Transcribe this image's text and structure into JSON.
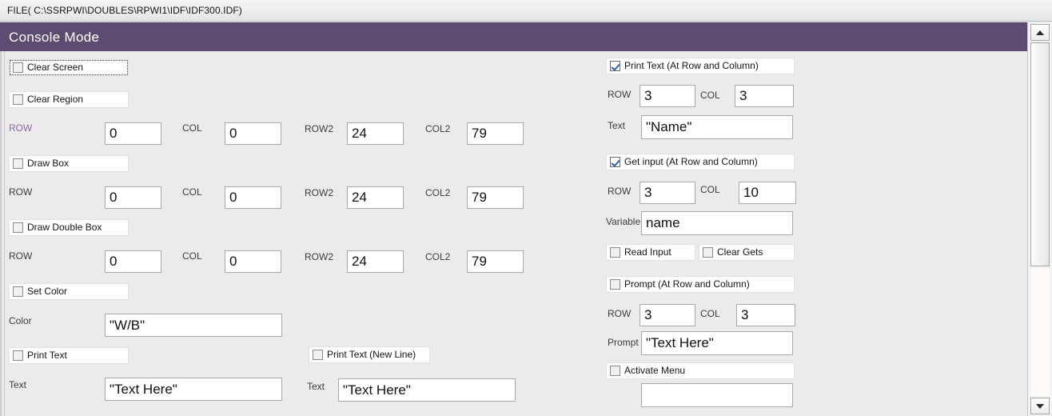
{
  "titlebar": {
    "file_path": "FILE( C:\\SSRPWI\\DOUBLES\\RPWI1\\IDF\\IDF300.IDF)"
  },
  "header": {
    "title": "Console Mode",
    "background_color": "#5e4b71",
    "text_color": "#ffffff"
  },
  "labels": {
    "row": "ROW",
    "col": "COL",
    "row2": "ROW2",
    "col2": "COL2",
    "color": "Color",
    "text": "Text",
    "variable": "Variable",
    "prompt": "Prompt"
  },
  "left_column": {
    "clear_screen": {
      "label": "Clear Screen",
      "checked": false,
      "focused": true
    },
    "clear_region": {
      "label": "Clear Region",
      "checked": false,
      "row_label": "ROW",
      "row_label_accent": true,
      "row_value": "0",
      "col_label": "COL",
      "col_value": "0",
      "row2_label": "ROW2",
      "row2_value": "24",
      "col2_label": "COL2",
      "col2_value": "79"
    },
    "draw_box": {
      "label": "Draw Box",
      "checked": false,
      "row_label": "ROW",
      "row_value": "0",
      "col_label": "COL",
      "col_value": "0",
      "row2_label": "ROW2",
      "row2_value": "24",
      "col2_label": "COL2",
      "col2_value": "79"
    },
    "draw_double_box": {
      "label": "Draw Double Box",
      "checked": false,
      "row_label": "ROW",
      "row_value": "0",
      "col_label": "COL",
      "col_value": "0",
      "row2_label": "ROW2",
      "row2_value": "24",
      "col2_label": "COL2",
      "col2_value": "79"
    },
    "set_color": {
      "label": "Set Color",
      "checked": false,
      "color_label": "Color",
      "color_value": "\"W/B\""
    },
    "print_text": {
      "label": "Print Text",
      "checked": false,
      "text_label": "Text",
      "text_value": "\"Text Here\""
    }
  },
  "middle_column": {
    "print_text_new_line": {
      "label": "Print Text (New Line)",
      "checked": false,
      "text_label": "Text",
      "text_value": "\"Text Here\""
    }
  },
  "right_column": {
    "print_text_at_row_col": {
      "label": "Print Text (At Row and Column)",
      "checked": true,
      "row_label": "ROW",
      "row_value": "3",
      "col_label": "COL",
      "col_value": "3",
      "text_label": "Text",
      "text_value": "\"Name\""
    },
    "get_input_at_row_col": {
      "label": "Get input (At Row and Column)",
      "checked": true,
      "row_label": "ROW",
      "row_value": "3",
      "col_label": "COL",
      "col_value": "10",
      "variable_label": "Variable",
      "variable_value": "name"
    },
    "read_input": {
      "label": "Read Input",
      "checked": false
    },
    "clear_gets": {
      "label": "Clear Gets",
      "checked": false
    },
    "prompt_at_row_col": {
      "label": "Prompt (At Row and Column)",
      "checked": false,
      "row_label": "ROW",
      "row_value": "3",
      "col_label": "COL",
      "col_value": "3",
      "prompt_label": "Prompt",
      "prompt_value": "\"Text Here\""
    },
    "activate_menu": {
      "label": "Activate Menu",
      "checked": false,
      "menu_value": ""
    }
  },
  "scrollbar": {
    "up_arrow": "scroll-up-arrow",
    "down_arrow": "scroll-down-arrow"
  }
}
